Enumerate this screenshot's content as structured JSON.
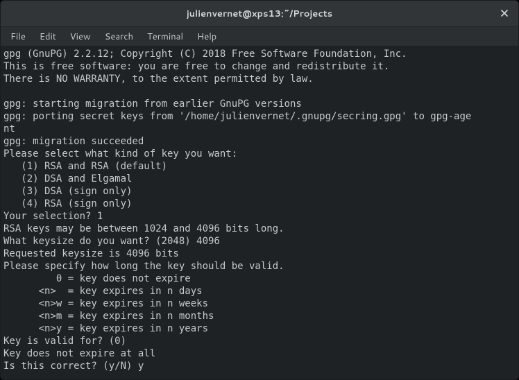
{
  "window": {
    "title": "julienvernet@xps13:~/Projects"
  },
  "menubar": {
    "items": [
      "File",
      "Edit",
      "View",
      "Search",
      "Terminal",
      "Help"
    ]
  },
  "terminal": {
    "lines": [
      "gpg (GnuPG) 2.2.12; Copyright (C) 2018 Free Software Foundation, Inc.",
      "This is free software: you are free to change and redistribute it.",
      "There is NO WARRANTY, to the extent permitted by law.",
      "",
      "gpg: starting migration from earlier GnuPG versions",
      "gpg: porting secret keys from '/home/julienvernet/.gnupg/secring.gpg' to gpg-age",
      "nt",
      "gpg: migration succeeded",
      "Please select what kind of key you want:",
      "   (1) RSA and RSA (default)",
      "   (2) DSA and Elgamal",
      "   (3) DSA (sign only)",
      "   (4) RSA (sign only)",
      "Your selection? 1",
      "RSA keys may be between 1024 and 4096 bits long.",
      "What keysize do you want? (2048) 4096",
      "Requested keysize is 4096 bits",
      "Please specify how long the key should be valid.",
      "         0 = key does not expire",
      "      <n>  = key expires in n days",
      "      <n>w = key expires in n weeks",
      "      <n>m = key expires in n months",
      "      <n>y = key expires in n years",
      "Key is valid for? (0)",
      "Key does not expire at all",
      "Is this correct? (y/N) y"
    ]
  }
}
